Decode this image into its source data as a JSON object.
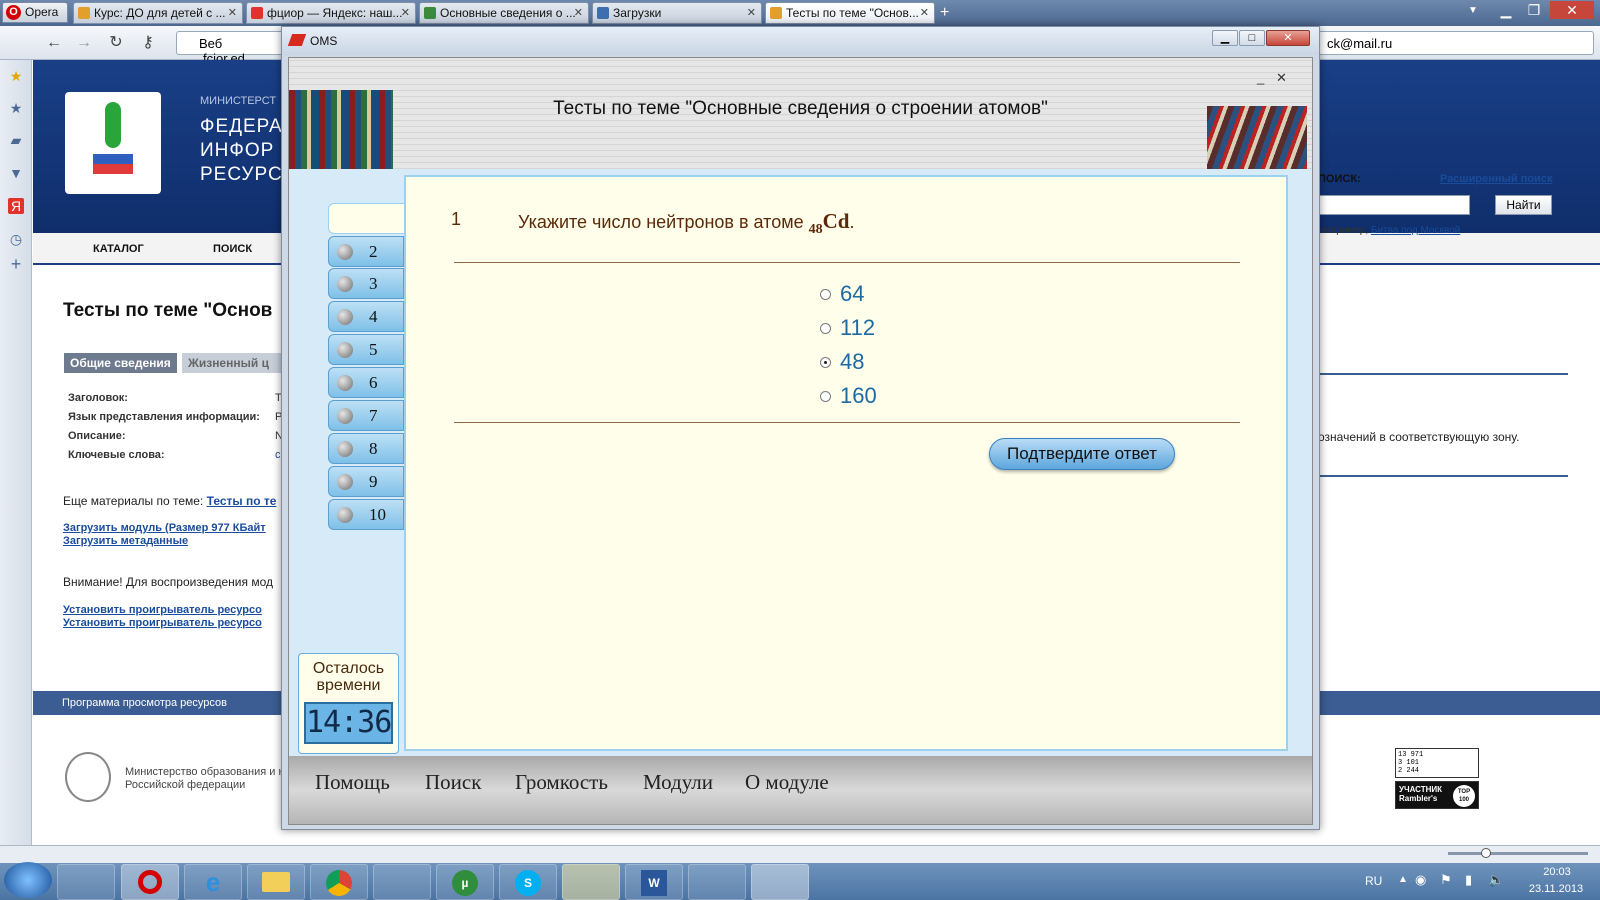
{
  "browser": {
    "opera_label": "Opera",
    "tabs": [
      {
        "title": "Курс: ДО для детей с ...",
        "color": "#e39f2c"
      },
      {
        "title": "фциор — Яндекс: наш...",
        "color": "#e1322b"
      },
      {
        "title": "Основные сведения о ...",
        "color": "#3d8a3d"
      },
      {
        "title": "Загрузки",
        "color": "#3d6fb0"
      },
      {
        "title": "Тесты по теме \"Основ...",
        "color": "#e39f2c"
      }
    ],
    "web_label": "Веб",
    "address": "fcior.ed",
    "search_value": "ck@mail.ru"
  },
  "site": {
    "header_small": "МИНИСТЕРСТ",
    "header_lines": [
      "ФЕДЕРА",
      "ИНФОР",
      "РЕСУРС"
    ],
    "nav": [
      "КАТАЛОГ",
      "ПОИСК"
    ],
    "page_title": "Тесты по теме \"Основ",
    "tabs": [
      "Общие сведения",
      "Жизненный ц"
    ],
    "meta_labels": [
      "Заголовок:",
      "Язык представления информации:",
      "Описание:",
      "Ключевые слова:"
    ],
    "meta_values": [
      "Т",
      "Р",
      "N",
      "с"
    ],
    "more_label": "Еще материалы по теме:",
    "more_link": "Тесты по те",
    "download_link": "Загрузить модуль (Размер 977 КБайт",
    "meta_link": "Загрузить метаданные",
    "attention": "Внимание! Для воспроизведения мод",
    "install_links": [
      "Установить проигрыватель ресурсо",
      "Установить проигрыватель ресурсо"
    ],
    "footer_bar": "Программа просмотра ресурсов",
    "footer_ministry": [
      "Министерство образования и н",
      "Российской федерации"
    ],
    "search_label": "ПОИСК:",
    "adv_search": "Расширенный поиск",
    "find_button": "Найти",
    "example_prefix": "Например,",
    "example_link": "Битва под Москвой",
    "right_text": "означений в соответствующую зону.",
    "counter_digits": [
      "13 971",
      "3 101",
      "2 244"
    ],
    "rambler_label": "УЧАСТНИК",
    "rambler_name": "Rambler's",
    "rambler_top": "TOP 100"
  },
  "oms": {
    "window_title": "OMS",
    "header_title": "Тесты по теме \"Основные сведения о строении атомов\"",
    "question_number": "1",
    "question_text": "Укажите число нейтронов в атоме",
    "element_subscript": "48",
    "element_symbol": "Cd",
    "question_end": ".",
    "answers": [
      {
        "label": "64",
        "selected": false
      },
      {
        "label": "112",
        "selected": false
      },
      {
        "label": "48",
        "selected": true
      },
      {
        "label": "160",
        "selected": false
      }
    ],
    "confirm_button": "Подтвердите ответ",
    "question_tabs": [
      "2",
      "3",
      "4",
      "5",
      "6",
      "7",
      "8",
      "9",
      "10"
    ],
    "timer_label_1": "Осталось",
    "timer_label_2": "времени",
    "timer_value": "14:36",
    "footer_buttons": [
      "Помощь",
      "Поиск",
      "Громкость",
      "Модули",
      "О модуле"
    ]
  },
  "taskbar": {
    "language": "RU",
    "time": "20:03",
    "date": "23.11.2013"
  }
}
